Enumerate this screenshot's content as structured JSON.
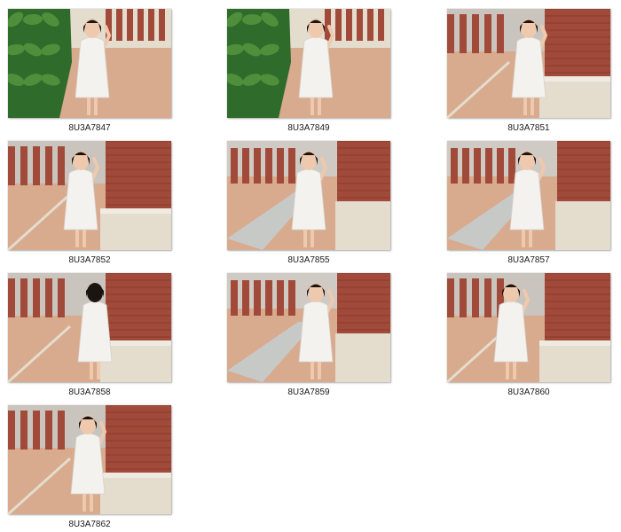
{
  "gallery": {
    "items": [
      {
        "filename": "8U3A7847",
        "scene": "garden"
      },
      {
        "filename": "8U3A7849",
        "scene": "garden"
      },
      {
        "filename": "8U3A7851",
        "scene": "corner"
      },
      {
        "filename": "8U3A7852",
        "scene": "corner"
      },
      {
        "filename": "8U3A7855",
        "scene": "street"
      },
      {
        "filename": "8U3A7857",
        "scene": "street"
      },
      {
        "filename": "8U3A7858",
        "scene": "corner"
      },
      {
        "filename": "8U3A7859",
        "scene": "street"
      },
      {
        "filename": "8U3A7860",
        "scene": "corner"
      },
      {
        "filename": "8U3A7862",
        "scene": "corner"
      }
    ]
  },
  "colors": {
    "background": "#ffffff",
    "label_text": "#1a1a1a",
    "brick": "#a24a3a",
    "pavement": "#d8aa8e",
    "stone": "#e4dccd",
    "foliage": "#2f6b2a",
    "dress": "#f4f2ef",
    "hair": "#1c1411",
    "skin": "#efc9ae"
  }
}
